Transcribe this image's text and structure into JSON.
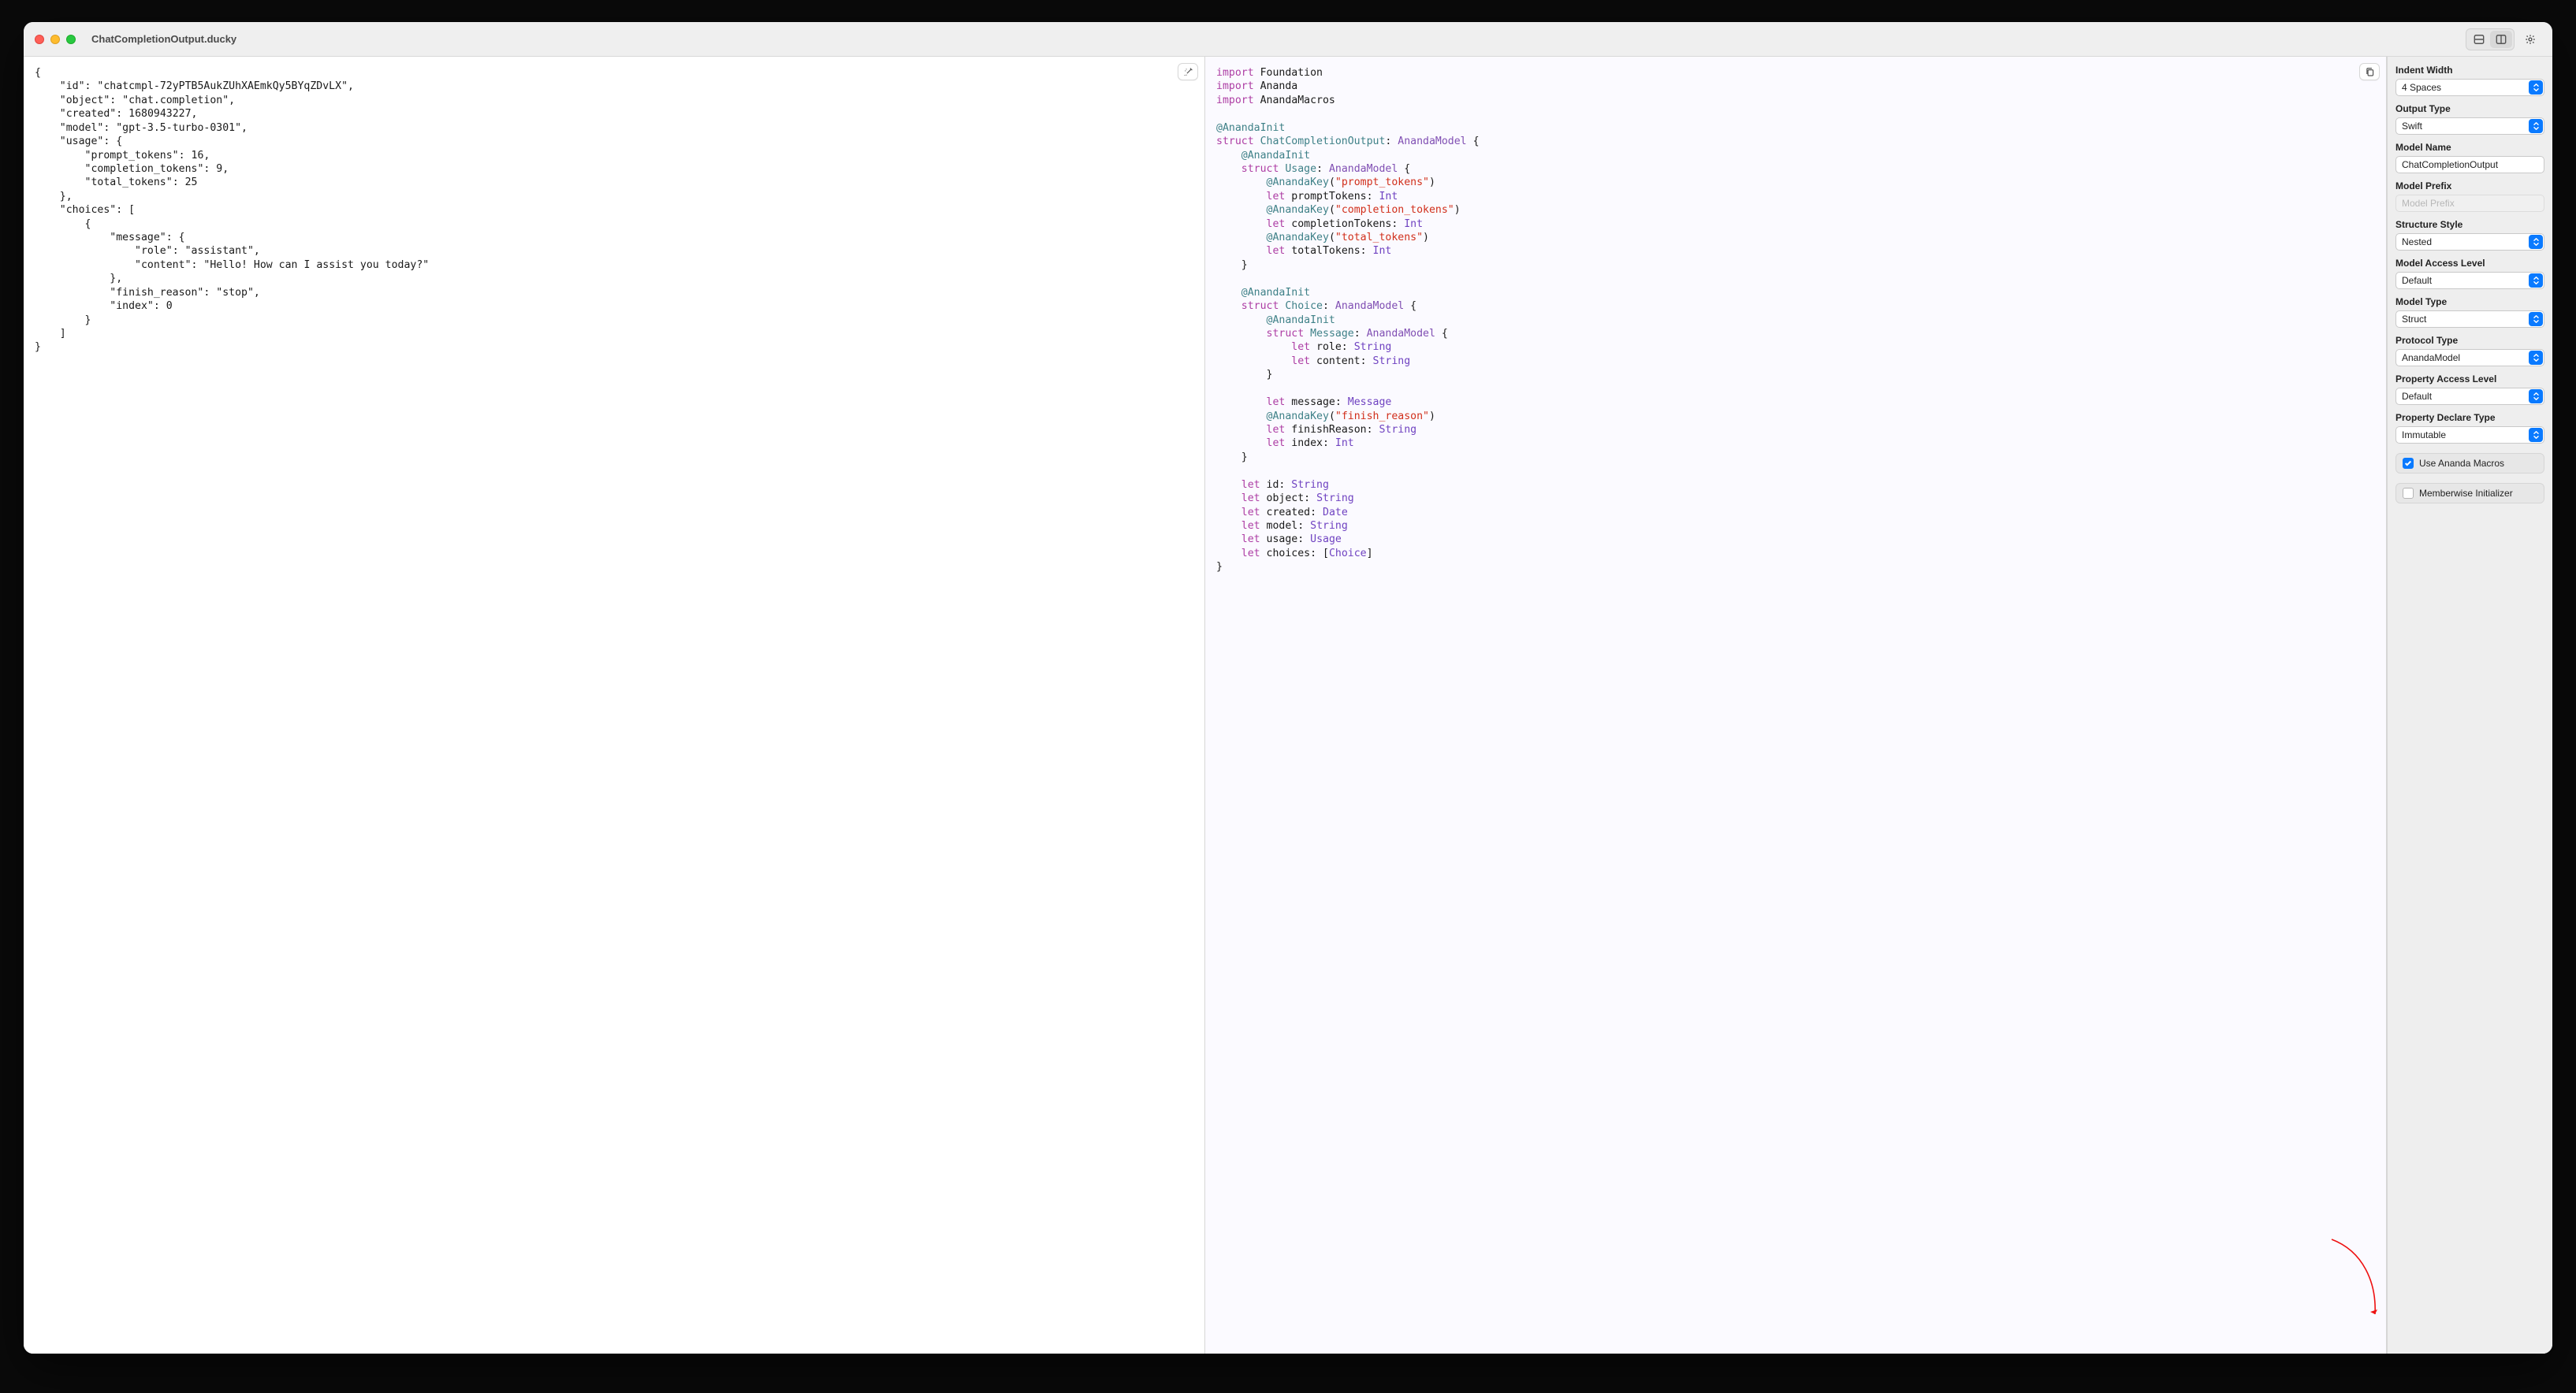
{
  "window": {
    "title": "ChatCompletionOutput.ducky"
  },
  "json_source": {
    "tokens": [
      {
        "t": "{",
        "c": "j-punc",
        "nl": true,
        "ind": 0
      },
      {
        "t": "\"id\"",
        "c": "j-key",
        "ind": 1
      },
      {
        "t": ": ",
        "c": "j-punc"
      },
      {
        "t": "\"chatcmpl-72yPTB5AukZUhXAEmkQy5BYqZDvLX\"",
        "c": "j-str"
      },
      {
        "t": ",",
        "c": "j-punc",
        "nl": true
      },
      {
        "t": "\"object\"",
        "c": "j-key",
        "ind": 1
      },
      {
        "t": ": ",
        "c": "j-punc"
      },
      {
        "t": "\"chat.completion\"",
        "c": "j-str"
      },
      {
        "t": ",",
        "c": "j-punc",
        "nl": true
      },
      {
        "t": "\"created\"",
        "c": "j-key",
        "ind": 1
      },
      {
        "t": ": ",
        "c": "j-punc"
      },
      {
        "t": "1680943227",
        "c": "j-num"
      },
      {
        "t": ",",
        "c": "j-punc",
        "nl": true
      },
      {
        "t": "\"model\"",
        "c": "j-key",
        "ind": 1
      },
      {
        "t": ": ",
        "c": "j-punc"
      },
      {
        "t": "\"gpt-3.5-turbo-0301\"",
        "c": "j-str"
      },
      {
        "t": ",",
        "c": "j-punc",
        "nl": true
      },
      {
        "t": "\"usage\"",
        "c": "j-key",
        "ind": 1
      },
      {
        "t": ": {",
        "c": "j-punc",
        "nl": true
      },
      {
        "t": "\"prompt_tokens\"",
        "c": "j-key",
        "ind": 2
      },
      {
        "t": ": ",
        "c": "j-punc"
      },
      {
        "t": "16",
        "c": "j-num"
      },
      {
        "t": ",",
        "c": "j-punc",
        "nl": true
      },
      {
        "t": "\"completion_tokens\"",
        "c": "j-key",
        "ind": 2
      },
      {
        "t": ": ",
        "c": "j-punc"
      },
      {
        "t": "9",
        "c": "j-num"
      },
      {
        "t": ",",
        "c": "j-punc",
        "nl": true
      },
      {
        "t": "\"total_tokens\"",
        "c": "j-key",
        "ind": 2
      },
      {
        "t": ": ",
        "c": "j-punc"
      },
      {
        "t": "25",
        "c": "j-num",
        "nl": true
      },
      {
        "t": "},",
        "c": "j-punc",
        "ind": 1,
        "nl": true
      },
      {
        "t": "\"choices\"",
        "c": "j-key",
        "ind": 1
      },
      {
        "t": ": [",
        "c": "j-punc",
        "nl": true
      },
      {
        "t": "{",
        "c": "j-punc",
        "ind": 2,
        "nl": true
      },
      {
        "t": "\"message\"",
        "c": "j-key",
        "ind": 3
      },
      {
        "t": ": {",
        "c": "j-punc",
        "nl": true
      },
      {
        "t": "\"role\"",
        "c": "j-key",
        "ind": 4
      },
      {
        "t": ": ",
        "c": "j-punc"
      },
      {
        "t": "\"assistant\"",
        "c": "j-str"
      },
      {
        "t": ",",
        "c": "j-punc",
        "nl": true
      },
      {
        "t": "\"content\"",
        "c": "j-key",
        "ind": 4
      },
      {
        "t": ": ",
        "c": "j-punc"
      },
      {
        "t": "\"Hello! How can I assist you today?\"",
        "c": "j-str",
        "nl": true
      },
      {
        "t": "},",
        "c": "j-punc",
        "ind": 3,
        "nl": true
      },
      {
        "t": "\"finish_reason\"",
        "c": "j-key",
        "ind": 3
      },
      {
        "t": ": ",
        "c": "j-punc"
      },
      {
        "t": "\"stop\"",
        "c": "j-str"
      },
      {
        "t": ",",
        "c": "j-punc",
        "nl": true
      },
      {
        "t": "\"index\"",
        "c": "j-key",
        "ind": 3
      },
      {
        "t": ": ",
        "c": "j-punc"
      },
      {
        "t": "0",
        "c": "j-num",
        "nl": true
      },
      {
        "t": "}",
        "c": "j-punc",
        "ind": 2,
        "nl": true
      },
      {
        "t": "]",
        "c": "j-punc",
        "ind": 1,
        "nl": true
      },
      {
        "t": "}",
        "c": "j-punc",
        "ind": 0,
        "nl": false
      }
    ]
  },
  "swift_output": {
    "tokens": [
      {
        "t": "import",
        "c": "sw-kw",
        "ind": 0
      },
      {
        "t": " ",
        "c": ""
      },
      {
        "t": "Foundation",
        "c": "sw-ident",
        "nl": true
      },
      {
        "t": "import",
        "c": "sw-kw",
        "ind": 0
      },
      {
        "t": " ",
        "c": ""
      },
      {
        "t": "Ananda",
        "c": "sw-ident",
        "nl": true
      },
      {
        "t": "import",
        "c": "sw-kw",
        "ind": 0
      },
      {
        "t": " ",
        "c": ""
      },
      {
        "t": "AnandaMacros",
        "c": "sw-ident",
        "nl": true
      },
      {
        "t": "",
        "nl": true,
        "ind": 0
      },
      {
        "t": "@AnandaInit",
        "c": "sw-at",
        "ind": 0,
        "nl": true
      },
      {
        "t": "struct",
        "c": "sw-kw",
        "ind": 0
      },
      {
        "t": " ",
        "c": ""
      },
      {
        "t": "ChatCompletionOutput",
        "c": "sw-deft"
      },
      {
        "t": ": ",
        "c": "sw-ident"
      },
      {
        "t": "AnandaModel",
        "c": "sw-proto"
      },
      {
        "t": " {",
        "c": "sw-ident",
        "nl": true
      },
      {
        "t": "@AnandaInit",
        "c": "sw-at",
        "ind": 1,
        "nl": true
      },
      {
        "t": "struct",
        "c": "sw-kw",
        "ind": 1
      },
      {
        "t": " ",
        "c": ""
      },
      {
        "t": "Usage",
        "c": "sw-deft"
      },
      {
        "t": ": ",
        "c": "sw-ident"
      },
      {
        "t": "AnandaModel",
        "c": "sw-proto"
      },
      {
        "t": " {",
        "c": "sw-ident",
        "nl": true
      },
      {
        "t": "@AnandaKey",
        "c": "sw-atkey",
        "ind": 2
      },
      {
        "t": "(",
        "c": "sw-ident"
      },
      {
        "t": "\"prompt_tokens\"",
        "c": "sw-str"
      },
      {
        "t": ")",
        "c": "sw-ident",
        "nl": true
      },
      {
        "t": "let",
        "c": "sw-kw",
        "ind": 2
      },
      {
        "t": " promptTokens: ",
        "c": "sw-ident"
      },
      {
        "t": "Int",
        "c": "sw-prim",
        "nl": true
      },
      {
        "t": "@AnandaKey",
        "c": "sw-atkey",
        "ind": 2
      },
      {
        "t": "(",
        "c": "sw-ident"
      },
      {
        "t": "\"completion_tokens\"",
        "c": "sw-str"
      },
      {
        "t": ")",
        "c": "sw-ident",
        "nl": true
      },
      {
        "t": "let",
        "c": "sw-kw",
        "ind": 2
      },
      {
        "t": " completionTokens: ",
        "c": "sw-ident"
      },
      {
        "t": "Int",
        "c": "sw-prim",
        "nl": true
      },
      {
        "t": "@AnandaKey",
        "c": "sw-atkey",
        "ind": 2
      },
      {
        "t": "(",
        "c": "sw-ident"
      },
      {
        "t": "\"total_tokens\"",
        "c": "sw-str"
      },
      {
        "t": ")",
        "c": "sw-ident",
        "nl": true
      },
      {
        "t": "let",
        "c": "sw-kw",
        "ind": 2
      },
      {
        "t": " totalTokens: ",
        "c": "sw-ident"
      },
      {
        "t": "Int",
        "c": "sw-prim",
        "nl": true
      },
      {
        "t": "}",
        "c": "sw-ident",
        "ind": 1,
        "nl": true
      },
      {
        "t": "",
        "nl": true,
        "ind": 0
      },
      {
        "t": "@AnandaInit",
        "c": "sw-at",
        "ind": 1,
        "nl": true
      },
      {
        "t": "struct",
        "c": "sw-kw",
        "ind": 1
      },
      {
        "t": " ",
        "c": ""
      },
      {
        "t": "Choice",
        "c": "sw-deft"
      },
      {
        "t": ": ",
        "c": "sw-ident"
      },
      {
        "t": "AnandaModel",
        "c": "sw-proto"
      },
      {
        "t": " {",
        "c": "sw-ident",
        "nl": true
      },
      {
        "t": "@AnandaInit",
        "c": "sw-at",
        "ind": 2,
        "nl": true
      },
      {
        "t": "struct",
        "c": "sw-kw",
        "ind": 2
      },
      {
        "t": " ",
        "c": ""
      },
      {
        "t": "Message",
        "c": "sw-deft"
      },
      {
        "t": ": ",
        "c": "sw-ident"
      },
      {
        "t": "AnandaModel",
        "c": "sw-proto"
      },
      {
        "t": " {",
        "c": "sw-ident",
        "nl": true
      },
      {
        "t": "let",
        "c": "sw-kw",
        "ind": 3
      },
      {
        "t": " role: ",
        "c": "sw-ident"
      },
      {
        "t": "String",
        "c": "sw-prim",
        "nl": true
      },
      {
        "t": "let",
        "c": "sw-kw",
        "ind": 3
      },
      {
        "t": " content: ",
        "c": "sw-ident"
      },
      {
        "t": "String",
        "c": "sw-prim",
        "nl": true
      },
      {
        "t": "}",
        "c": "sw-ident",
        "ind": 2,
        "nl": true
      },
      {
        "t": "",
        "nl": true,
        "ind": 0
      },
      {
        "t": "let",
        "c": "sw-kw",
        "ind": 2
      },
      {
        "t": " message: ",
        "c": "sw-ident"
      },
      {
        "t": "Message",
        "c": "sw-prim",
        "nl": true
      },
      {
        "t": "@AnandaKey",
        "c": "sw-atkey",
        "ind": 2
      },
      {
        "t": "(",
        "c": "sw-ident"
      },
      {
        "t": "\"finish_reason\"",
        "c": "sw-str"
      },
      {
        "t": ")",
        "c": "sw-ident",
        "nl": true
      },
      {
        "t": "let",
        "c": "sw-kw",
        "ind": 2
      },
      {
        "t": " finishReason: ",
        "c": "sw-ident"
      },
      {
        "t": "String",
        "c": "sw-prim",
        "nl": true
      },
      {
        "t": "let",
        "c": "sw-kw",
        "ind": 2
      },
      {
        "t": " index: ",
        "c": "sw-ident"
      },
      {
        "t": "Int",
        "c": "sw-prim",
        "nl": true
      },
      {
        "t": "}",
        "c": "sw-ident",
        "ind": 1,
        "nl": true
      },
      {
        "t": "",
        "nl": true,
        "ind": 0
      },
      {
        "t": "let",
        "c": "sw-kw",
        "ind": 1
      },
      {
        "t": " id: ",
        "c": "sw-ident"
      },
      {
        "t": "String",
        "c": "sw-prim",
        "nl": true
      },
      {
        "t": "let",
        "c": "sw-kw",
        "ind": 1
      },
      {
        "t": " object: ",
        "c": "sw-ident"
      },
      {
        "t": "String",
        "c": "sw-prim",
        "nl": true
      },
      {
        "t": "let",
        "c": "sw-kw",
        "ind": 1
      },
      {
        "t": " created: ",
        "c": "sw-ident"
      },
      {
        "t": "Date",
        "c": "sw-prim",
        "nl": true
      },
      {
        "t": "let",
        "c": "sw-kw",
        "ind": 1
      },
      {
        "t": " model: ",
        "c": "sw-ident"
      },
      {
        "t": "String",
        "c": "sw-prim",
        "nl": true
      },
      {
        "t": "let",
        "c": "sw-kw",
        "ind": 1
      },
      {
        "t": " usage: ",
        "c": "sw-ident"
      },
      {
        "t": "Usage",
        "c": "sw-prim",
        "nl": true
      },
      {
        "t": "let",
        "c": "sw-kw",
        "ind": 1
      },
      {
        "t": " choices: [",
        "c": "sw-ident"
      },
      {
        "t": "Choice",
        "c": "sw-prim"
      },
      {
        "t": "]",
        "c": "sw-ident",
        "nl": true
      },
      {
        "t": "}",
        "c": "sw-ident",
        "ind": 0
      }
    ]
  },
  "sidebar": {
    "indent_width": {
      "label": "Indent Width",
      "value": "4 Spaces"
    },
    "output_type": {
      "label": "Output Type",
      "value": "Swift"
    },
    "model_name": {
      "label": "Model Name",
      "value": "ChatCompletionOutput"
    },
    "model_prefix": {
      "label": "Model Prefix",
      "placeholder": "Model Prefix",
      "value": ""
    },
    "structure_style": {
      "label": "Structure Style",
      "value": "Nested"
    },
    "model_access_level": {
      "label": "Model Access Level",
      "value": "Default"
    },
    "model_type": {
      "label": "Model Type",
      "value": "Struct"
    },
    "protocol_type": {
      "label": "Protocol Type",
      "value": "AnandaModel"
    },
    "property_access_level": {
      "label": "Property Access Level",
      "value": "Default"
    },
    "property_declare_type": {
      "label": "Property Declare Type",
      "value": "Immutable"
    },
    "use_ananda_macros": {
      "label": "Use Ananda Macros",
      "checked": true
    },
    "memberwise_init": {
      "label": "Memberwise Initializer",
      "checked": false
    }
  }
}
